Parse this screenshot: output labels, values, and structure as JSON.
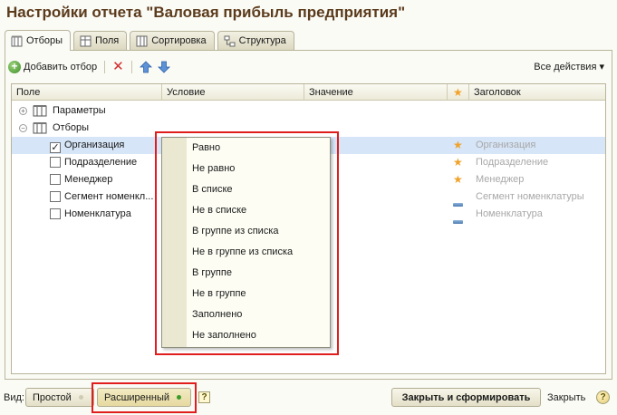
{
  "window": {
    "title": "Настройки отчета \"Валовая прибыль предприятия\""
  },
  "tabs": [
    {
      "label": "Отборы",
      "icon": "filter-icon",
      "active": true
    },
    {
      "label": "Поля",
      "icon": "fields-icon",
      "active": false
    },
    {
      "label": "Сортировка",
      "icon": "sort-icon",
      "active": false
    },
    {
      "label": "Структура",
      "icon": "structure-icon",
      "active": false
    }
  ],
  "toolbar": {
    "add_filter_label": "Добавить отбор",
    "all_actions_label": "Все действия ▾"
  },
  "table": {
    "columns": [
      "Поле",
      "Условие",
      "Значение",
      "★",
      "Заголовок"
    ],
    "groups": [
      {
        "label": "Параметры",
        "expander": "+"
      },
      {
        "label": "Отборы",
        "expander": "−"
      }
    ],
    "rows": [
      {
        "field": "Организация",
        "checked": true,
        "marker": "★",
        "heading": "Организация",
        "selected": true
      },
      {
        "field": "Подразделение",
        "checked": false,
        "marker": "★",
        "heading": "Подразделение",
        "selected": false
      },
      {
        "field": "Менеджер",
        "checked": false,
        "marker": "★",
        "heading": "Менеджер",
        "selected": false
      },
      {
        "field": "Сегмент номенкл...",
        "checked": false,
        "marker": "dash",
        "heading": "Сегмент номенклатуры",
        "selected": false
      },
      {
        "field": "Номенклатура",
        "checked": false,
        "marker": "dash",
        "heading": "Номенклатура",
        "selected": false
      }
    ]
  },
  "condition_dropdown": {
    "options": [
      "Равно",
      "Не равно",
      "В списке",
      "Не в списке",
      "В группе из списка",
      "Не в группе из списка",
      "В группе",
      "Не в группе",
      "Заполнено",
      "Не заполнено"
    ]
  },
  "bottom_bar": {
    "view_label": "Вид:",
    "simple_label": "Простой",
    "extended_label": "Расширенный",
    "help_square": "?",
    "primary_label": "Закрыть и сформировать",
    "close_label": "Закрыть",
    "help_circle": "?"
  },
  "colors": {
    "title": "#5b3b1c",
    "selected_row": "#d6e5f7",
    "highlight_frame": "#e01e1e",
    "star": "#f0a22a",
    "active_led": "#3a9a2a"
  }
}
